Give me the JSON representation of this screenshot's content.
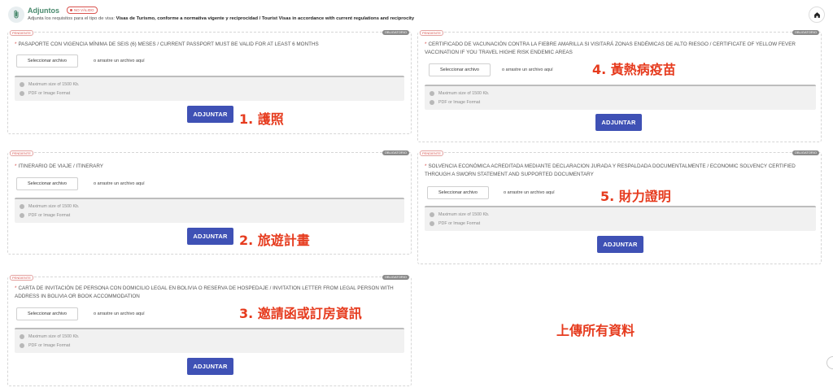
{
  "header": {
    "title": "Adjuntos",
    "invalid_badge": "NO VÁLIDO",
    "subtitle_prefix": "Adjunta los requisitos para el tipo de visa: ",
    "subtitle_bold": "Visas de Turismo, conforme a normativa vigente y reciprocidad / Tourist Visas in accordance with current regulations and reciprocity"
  },
  "common": {
    "pending": "PENDIENTE",
    "required": "OBLIGATORIO",
    "select_file": "Seleccionar archivo",
    "drag_here": "o arrastre un archivo aquí",
    "max_size": "Maximum size of 1500 Kb.",
    "format": "PDF or Image Format",
    "submit": "ADJUNTAR"
  },
  "requirements": [
    {
      "text": "PASAPORTE CON VIGENCIA MÍNIMA DE SEIS (6) MESES / CURRENT PASSPORT MUST BE VALID FOR AT LEAST 6 MONTHS",
      "annotation": "1. 護照"
    },
    {
      "text": "ITINERARIO DE VIAJE / ITINERARY",
      "annotation": "2. 旅遊計畫"
    },
    {
      "text": "CARTA DE INVITACIÓN DE PERSONA CON DOMICILIO LEGAL EN BOLIVIA O RESERVA DE HOSPEDAJE / INVITATION LETTER FROM LEGAL PERSON WITH ADDRESS IN BOLIVIA OR BOOK ACCOMMODATION",
      "annotation": "3. 邀請函或訂房資訊"
    },
    {
      "text": "CERTIFICADO DE VACUNACIÓN CONTRA LA FIEBRE AMARILLA SI VISITARÁ ZONAS ENDÉMICAS DE ALTO RIESGO / CERTIFICATE OF YELLOW FEVER VACCINATION IF YOU TRAVEL HIGHE RISK ENDEMIC AREAS",
      "annotation": "4. 黃熱病疫苗"
    },
    {
      "text": "SOLVENCIA ECONÓMICA ACREDITADA MEDIANTE DECLARACION JURADA Y RESPALDADA DOCUMENTALMENTE / ECONOMIC SOLVENCY CERTIFIED THROUGH A SWORN STATEMENT AND SUPPORTED DOCUMENTARY",
      "annotation": "5. 財力證明"
    }
  ],
  "bottom_note": "上傳所有資料",
  "colors": {
    "accent": "#3f51b5",
    "annotation": "#e63b1e",
    "title": "#4a8a6e"
  }
}
